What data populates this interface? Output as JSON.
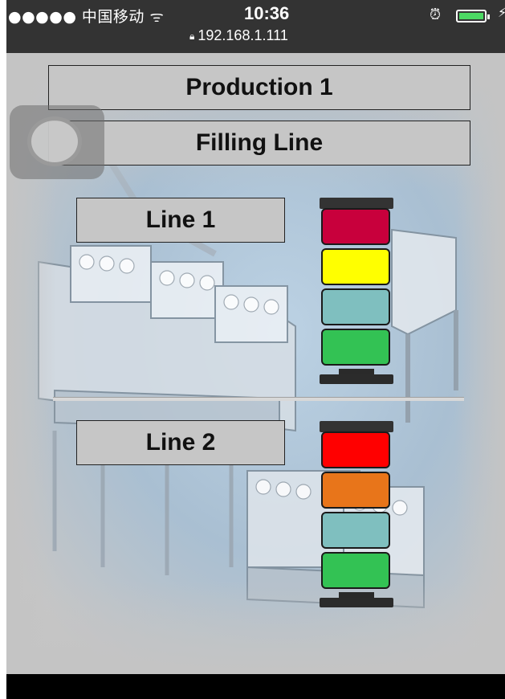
{
  "status_bar": {
    "carrier": "●●●●● 中国移动 ᯤ",
    "time": "10:36",
    "url": "192.168.1.111",
    "lock_icon": "lock-icon",
    "alarm_icon": "alarm-clock-icon",
    "battery_icon": "battery-icon",
    "charging_icon": "charging-bolt-icon"
  },
  "header": {
    "title": "Production 1",
    "subtitle": "Filling Line"
  },
  "lines": [
    {
      "label": "Line 1",
      "lights": [
        "#c8003c",
        "#ffff00",
        "#7fbfbf",
        "#33c254"
      ]
    },
    {
      "label": "Line 2",
      "lights": [
        "#ff0000",
        "#e8751a",
        "#7fbfbf",
        "#33c254"
      ]
    }
  ],
  "colors": {
    "status_bar_bg": "#333333",
    "content_bg": "#c4c4c4",
    "tower_frame": "#2b2b2b"
  }
}
